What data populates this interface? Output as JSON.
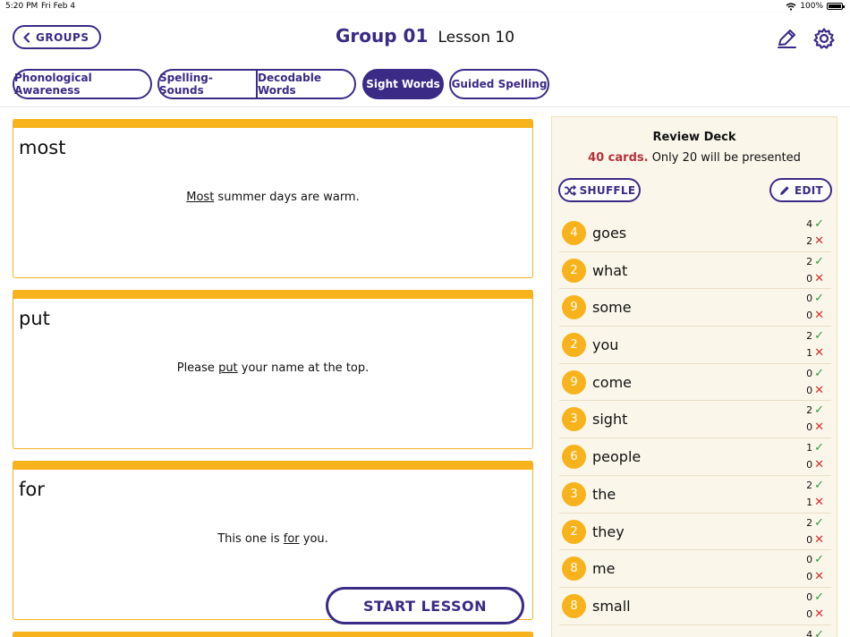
{
  "status": {
    "time": "5:20 PM",
    "date": "Fri Feb 4",
    "battery": "100%"
  },
  "header": {
    "back_label": "GROUPS",
    "group": "Group 01",
    "lesson": "Lesson 10"
  },
  "tabs": [
    {
      "label": "Phonological Awareness",
      "active": false
    },
    {
      "label": "Spelling-Sounds",
      "active": false
    },
    {
      "label": "Decodable Words",
      "active": false
    },
    {
      "label": "Sight Words",
      "active": true
    },
    {
      "label": "Guided Spelling",
      "active": false
    }
  ],
  "cards": [
    {
      "word": "most",
      "pre": "",
      "highlight": "Most",
      "post": " summer days are warm."
    },
    {
      "word": "put",
      "pre": "Please ",
      "highlight": "put",
      "post": " your name at the top."
    },
    {
      "word": "for",
      "pre": "This one is ",
      "highlight": "for",
      "post": " you."
    }
  ],
  "start_label": "START LESSON",
  "review": {
    "title": "Review Deck",
    "count": "40 cards.",
    "note": " Only 20 will be presented",
    "shuffle_label": "SHUFFLE",
    "edit_label": "EDIT",
    "items": [
      {
        "num": "4",
        "word": "goes",
        "right": "4",
        "wrong": "2"
      },
      {
        "num": "2",
        "word": "what",
        "right": "2",
        "wrong": "0"
      },
      {
        "num": "9",
        "word": "some",
        "right": "0",
        "wrong": "0"
      },
      {
        "num": "2",
        "word": "you",
        "right": "2",
        "wrong": "1"
      },
      {
        "num": "9",
        "word": "come",
        "right": "0",
        "wrong": "0"
      },
      {
        "num": "3",
        "word": "sight",
        "right": "2",
        "wrong": "0"
      },
      {
        "num": "6",
        "word": "people",
        "right": "1",
        "wrong": "0"
      },
      {
        "num": "3",
        "word": "the",
        "right": "2",
        "wrong": "1"
      },
      {
        "num": "2",
        "word": "they",
        "right": "2",
        "wrong": "0"
      },
      {
        "num": "8",
        "word": "me",
        "right": "0",
        "wrong": "0"
      },
      {
        "num": "8",
        "word": "small",
        "right": "0",
        "wrong": "0"
      },
      {
        "num": "",
        "word": "",
        "right": "4",
        "wrong": ""
      }
    ]
  },
  "colors": {
    "brand": "#3b2a86",
    "accent": "#f8b31c",
    "correct": "#2f9a45",
    "incorrect": "#d2312f",
    "count": "#b5323b"
  },
  "icons": [
    "chevron-left-icon",
    "pencil-icon",
    "gear-icon",
    "shuffle-icon",
    "edit-pencil-icon",
    "check-icon",
    "cross-icon",
    "wifi-icon",
    "battery-icon"
  ]
}
